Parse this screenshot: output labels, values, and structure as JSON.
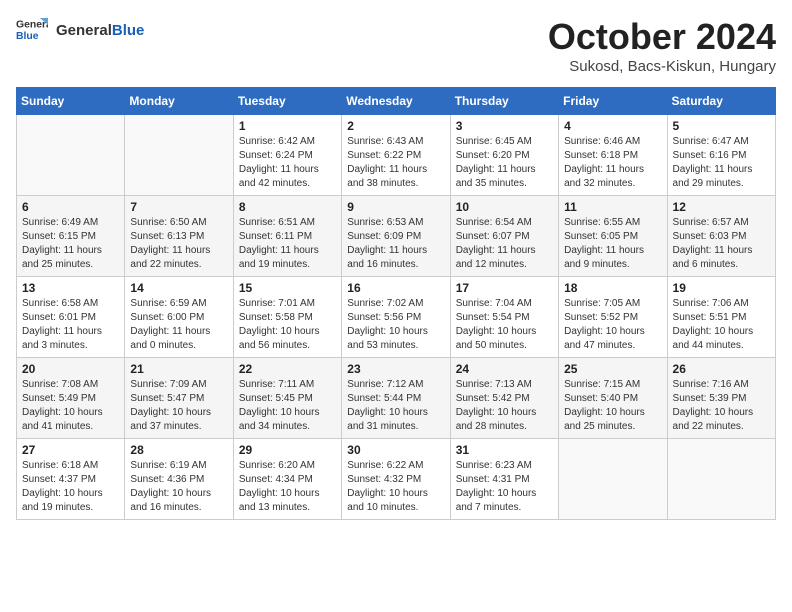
{
  "header": {
    "logo_general": "General",
    "logo_blue": "Blue",
    "month": "October 2024",
    "location": "Sukosd, Bacs-Kiskun, Hungary"
  },
  "weekdays": [
    "Sunday",
    "Monday",
    "Tuesday",
    "Wednesday",
    "Thursday",
    "Friday",
    "Saturday"
  ],
  "weeks": [
    [
      {
        "day": "",
        "sunrise": "",
        "sunset": "",
        "daylight": ""
      },
      {
        "day": "",
        "sunrise": "",
        "sunset": "",
        "daylight": ""
      },
      {
        "day": "1",
        "sunrise": "Sunrise: 6:42 AM",
        "sunset": "Sunset: 6:24 PM",
        "daylight": "Daylight: 11 hours and 42 minutes."
      },
      {
        "day": "2",
        "sunrise": "Sunrise: 6:43 AM",
        "sunset": "Sunset: 6:22 PM",
        "daylight": "Daylight: 11 hours and 38 minutes."
      },
      {
        "day": "3",
        "sunrise": "Sunrise: 6:45 AM",
        "sunset": "Sunset: 6:20 PM",
        "daylight": "Daylight: 11 hours and 35 minutes."
      },
      {
        "day": "4",
        "sunrise": "Sunrise: 6:46 AM",
        "sunset": "Sunset: 6:18 PM",
        "daylight": "Daylight: 11 hours and 32 minutes."
      },
      {
        "day": "5",
        "sunrise": "Sunrise: 6:47 AM",
        "sunset": "Sunset: 6:16 PM",
        "daylight": "Daylight: 11 hours and 29 minutes."
      }
    ],
    [
      {
        "day": "6",
        "sunrise": "Sunrise: 6:49 AM",
        "sunset": "Sunset: 6:15 PM",
        "daylight": "Daylight: 11 hours and 25 minutes."
      },
      {
        "day": "7",
        "sunrise": "Sunrise: 6:50 AM",
        "sunset": "Sunset: 6:13 PM",
        "daylight": "Daylight: 11 hours and 22 minutes."
      },
      {
        "day": "8",
        "sunrise": "Sunrise: 6:51 AM",
        "sunset": "Sunset: 6:11 PM",
        "daylight": "Daylight: 11 hours and 19 minutes."
      },
      {
        "day": "9",
        "sunrise": "Sunrise: 6:53 AM",
        "sunset": "Sunset: 6:09 PM",
        "daylight": "Daylight: 11 hours and 16 minutes."
      },
      {
        "day": "10",
        "sunrise": "Sunrise: 6:54 AM",
        "sunset": "Sunset: 6:07 PM",
        "daylight": "Daylight: 11 hours and 12 minutes."
      },
      {
        "day": "11",
        "sunrise": "Sunrise: 6:55 AM",
        "sunset": "Sunset: 6:05 PM",
        "daylight": "Daylight: 11 hours and 9 minutes."
      },
      {
        "day": "12",
        "sunrise": "Sunrise: 6:57 AM",
        "sunset": "Sunset: 6:03 PM",
        "daylight": "Daylight: 11 hours and 6 minutes."
      }
    ],
    [
      {
        "day": "13",
        "sunrise": "Sunrise: 6:58 AM",
        "sunset": "Sunset: 6:01 PM",
        "daylight": "Daylight: 11 hours and 3 minutes."
      },
      {
        "day": "14",
        "sunrise": "Sunrise: 6:59 AM",
        "sunset": "Sunset: 6:00 PM",
        "daylight": "Daylight: 11 hours and 0 minutes."
      },
      {
        "day": "15",
        "sunrise": "Sunrise: 7:01 AM",
        "sunset": "Sunset: 5:58 PM",
        "daylight": "Daylight: 10 hours and 56 minutes."
      },
      {
        "day": "16",
        "sunrise": "Sunrise: 7:02 AM",
        "sunset": "Sunset: 5:56 PM",
        "daylight": "Daylight: 10 hours and 53 minutes."
      },
      {
        "day": "17",
        "sunrise": "Sunrise: 7:04 AM",
        "sunset": "Sunset: 5:54 PM",
        "daylight": "Daylight: 10 hours and 50 minutes."
      },
      {
        "day": "18",
        "sunrise": "Sunrise: 7:05 AM",
        "sunset": "Sunset: 5:52 PM",
        "daylight": "Daylight: 10 hours and 47 minutes."
      },
      {
        "day": "19",
        "sunrise": "Sunrise: 7:06 AM",
        "sunset": "Sunset: 5:51 PM",
        "daylight": "Daylight: 10 hours and 44 minutes."
      }
    ],
    [
      {
        "day": "20",
        "sunrise": "Sunrise: 7:08 AM",
        "sunset": "Sunset: 5:49 PM",
        "daylight": "Daylight: 10 hours and 41 minutes."
      },
      {
        "day": "21",
        "sunrise": "Sunrise: 7:09 AM",
        "sunset": "Sunset: 5:47 PM",
        "daylight": "Daylight: 10 hours and 37 minutes."
      },
      {
        "day": "22",
        "sunrise": "Sunrise: 7:11 AM",
        "sunset": "Sunset: 5:45 PM",
        "daylight": "Daylight: 10 hours and 34 minutes."
      },
      {
        "day": "23",
        "sunrise": "Sunrise: 7:12 AM",
        "sunset": "Sunset: 5:44 PM",
        "daylight": "Daylight: 10 hours and 31 minutes."
      },
      {
        "day": "24",
        "sunrise": "Sunrise: 7:13 AM",
        "sunset": "Sunset: 5:42 PM",
        "daylight": "Daylight: 10 hours and 28 minutes."
      },
      {
        "day": "25",
        "sunrise": "Sunrise: 7:15 AM",
        "sunset": "Sunset: 5:40 PM",
        "daylight": "Daylight: 10 hours and 25 minutes."
      },
      {
        "day": "26",
        "sunrise": "Sunrise: 7:16 AM",
        "sunset": "Sunset: 5:39 PM",
        "daylight": "Daylight: 10 hours and 22 minutes."
      }
    ],
    [
      {
        "day": "27",
        "sunrise": "Sunrise: 6:18 AM",
        "sunset": "Sunset: 4:37 PM",
        "daylight": "Daylight: 10 hours and 19 minutes."
      },
      {
        "day": "28",
        "sunrise": "Sunrise: 6:19 AM",
        "sunset": "Sunset: 4:36 PM",
        "daylight": "Daylight: 10 hours and 16 minutes."
      },
      {
        "day": "29",
        "sunrise": "Sunrise: 6:20 AM",
        "sunset": "Sunset: 4:34 PM",
        "daylight": "Daylight: 10 hours and 13 minutes."
      },
      {
        "day": "30",
        "sunrise": "Sunrise: 6:22 AM",
        "sunset": "Sunset: 4:32 PM",
        "daylight": "Daylight: 10 hours and 10 minutes."
      },
      {
        "day": "31",
        "sunrise": "Sunrise: 6:23 AM",
        "sunset": "Sunset: 4:31 PM",
        "daylight": "Daylight: 10 hours and 7 minutes."
      },
      {
        "day": "",
        "sunrise": "",
        "sunset": "",
        "daylight": ""
      },
      {
        "day": "",
        "sunrise": "",
        "sunset": "",
        "daylight": ""
      }
    ]
  ]
}
